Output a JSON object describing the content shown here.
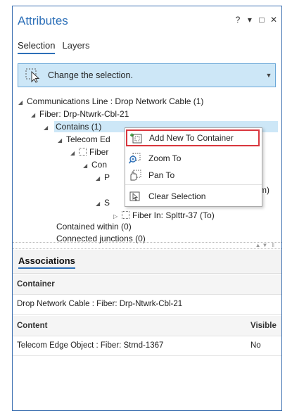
{
  "window": {
    "title": "Attributes",
    "controls": {
      "help": "?",
      "menu": "▾",
      "maximize": "□",
      "close": "✕"
    }
  },
  "tabs": [
    {
      "label": "Selection",
      "active": true
    },
    {
      "label": "Layers",
      "active": false
    }
  ],
  "change_selection": {
    "label": "Change the selection."
  },
  "tree": {
    "nodes": [
      {
        "label": "Communications Line : Drop Network Cable (1)"
      },
      {
        "label": "Fiber: Drp-Ntwrk-Cbl-21"
      },
      {
        "label": "Contains (1)"
      },
      {
        "label": "Telecom Ed"
      },
      {
        "label": "Fiber"
      },
      {
        "label": "Con"
      },
      {
        "label": "P"
      },
      {
        "label": "From)"
      },
      {
        "label": "S"
      },
      {
        "label": "Fiber In: Splttr-37 (To)"
      },
      {
        "label": "Contained within (0)"
      },
      {
        "label": "Connected junctions (0)"
      }
    ]
  },
  "context_menu": {
    "items": [
      {
        "label": "Add New To Container",
        "icon": "add-to-container-icon",
        "highlighted": true
      },
      {
        "label": "Zoom To",
        "icon": "zoom-to-icon"
      },
      {
        "label": "Pan To",
        "icon": "pan-to-icon"
      },
      {
        "label": "Clear Selection",
        "icon": "clear-selection-icon"
      }
    ]
  },
  "associations": {
    "tab_label": "Associations",
    "container_header": "Container",
    "container_value": "Drop Network Cable : Fiber: Drp-Ntwrk-Cbl-21",
    "content_header": "Content",
    "visible_header": "Visible",
    "content_value": "Telecom Edge Object : Fiber: Strnd-1367",
    "visible_value": "No"
  },
  "colors": {
    "accent": "#2c6fb8",
    "selection_bg": "#cde7f7",
    "highlight_outline": "#d9363e"
  }
}
